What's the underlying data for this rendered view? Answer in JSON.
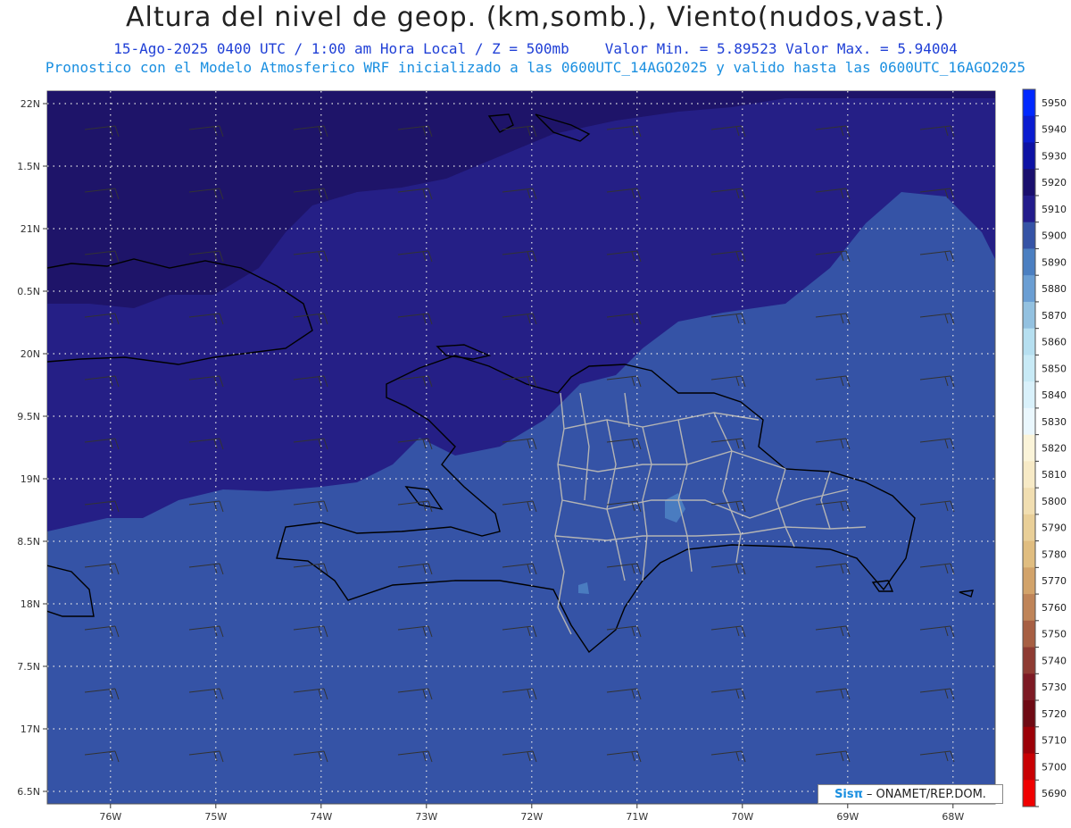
{
  "header": {
    "title": "Altura del nivel de geop. (km,somb.), Viento(nudos,vast.)",
    "date_line": "15-Ago-2025  0400 UTC / 1:00 am Hora Local / Z = 500mb",
    "minmax_line": "Valor Min. = 5.89523  Valor Max. = 5.94004",
    "model_line": "Pronostico con el Modelo Atmosferico WRF inicializado a las 0600UTC_14AGO2025 y valido hasta las  0600UTC_16AGO2025"
  },
  "axes": {
    "lat_labels": [
      "22N",
      "1.5N",
      "21N",
      "0.5N",
      "20N",
      "9.5N",
      "19N",
      "8.5N",
      "18N",
      "7.5N",
      "17N",
      "6.5N"
    ],
    "lat_values": [
      22,
      21.5,
      21,
      20.5,
      20,
      19.5,
      19,
      18.5,
      18,
      17.5,
      17,
      16.5
    ],
    "lon_labels": [
      "76W",
      "75W",
      "74W",
      "73W",
      "72W",
      "71W",
      "70W",
      "69W",
      "68W"
    ],
    "lon_values": [
      -76,
      -75,
      -74,
      -73,
      -72,
      -71,
      -70,
      -69,
      -68
    ],
    "lat_range": [
      16.4,
      22.1
    ],
    "lon_range": [
      -76.6,
      -67.6
    ]
  },
  "colorbar": {
    "levels": [
      "5950",
      "5940",
      "5930",
      "5920",
      "5910",
      "5900",
      "5890",
      "5880",
      "5870",
      "5860",
      "5850",
      "5840",
      "5830",
      "5820",
      "5810",
      "5800",
      "5790",
      "5780",
      "5770",
      "5760",
      "5750",
      "5740",
      "5730",
      "5720",
      "5710",
      "5700",
      "5690"
    ],
    "colors": [
      "#0028ff",
      "#0a1cd0",
      "#0d12a4",
      "#1a0f6e",
      "#231c8c",
      "#3553a6",
      "#4b7fc1",
      "#6a9ed3",
      "#93c1e0",
      "#b6dff0",
      "#c8eaf6",
      "#d9f1fb",
      "#eaf7fd",
      "#fbf4d9",
      "#f7eac6",
      "#f1deb1",
      "#e9cf98",
      "#e0bd80",
      "#d2a36a",
      "#bf8458",
      "#a75f43",
      "#8e3b32",
      "#7d1a24",
      "#6f0a14",
      "#9c0008",
      "#c80003",
      "#f00000"
    ]
  },
  "field_colors": {
    "level_5920": "#1e1469",
    "level_5910": "#251f86",
    "level_5900": "#3553a6",
    "level_5890": "#4a7cc0",
    "coast": "#000000",
    "borders": "#b4b4b4",
    "barbs": "#333333"
  },
  "credit": {
    "logo": "Sisπ",
    "text": "– ONAMET/REP.DOM."
  }
}
